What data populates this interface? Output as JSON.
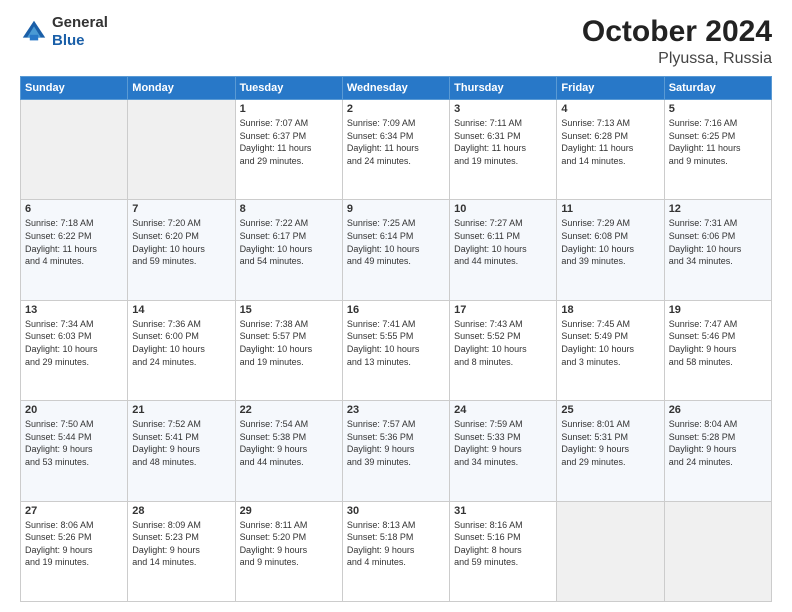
{
  "header": {
    "logo_general": "General",
    "logo_blue": "Blue",
    "month": "October 2024",
    "location": "Plyussa, Russia"
  },
  "days_of_week": [
    "Sunday",
    "Monday",
    "Tuesday",
    "Wednesday",
    "Thursday",
    "Friday",
    "Saturday"
  ],
  "weeks": [
    [
      {
        "day": "",
        "info": ""
      },
      {
        "day": "",
        "info": ""
      },
      {
        "day": "1",
        "info": "Sunrise: 7:07 AM\nSunset: 6:37 PM\nDaylight: 11 hours\nand 29 minutes."
      },
      {
        "day": "2",
        "info": "Sunrise: 7:09 AM\nSunset: 6:34 PM\nDaylight: 11 hours\nand 24 minutes."
      },
      {
        "day": "3",
        "info": "Sunrise: 7:11 AM\nSunset: 6:31 PM\nDaylight: 11 hours\nand 19 minutes."
      },
      {
        "day": "4",
        "info": "Sunrise: 7:13 AM\nSunset: 6:28 PM\nDaylight: 11 hours\nand 14 minutes."
      },
      {
        "day": "5",
        "info": "Sunrise: 7:16 AM\nSunset: 6:25 PM\nDaylight: 11 hours\nand 9 minutes."
      }
    ],
    [
      {
        "day": "6",
        "info": "Sunrise: 7:18 AM\nSunset: 6:22 PM\nDaylight: 11 hours\nand 4 minutes."
      },
      {
        "day": "7",
        "info": "Sunrise: 7:20 AM\nSunset: 6:20 PM\nDaylight: 10 hours\nand 59 minutes."
      },
      {
        "day": "8",
        "info": "Sunrise: 7:22 AM\nSunset: 6:17 PM\nDaylight: 10 hours\nand 54 minutes."
      },
      {
        "day": "9",
        "info": "Sunrise: 7:25 AM\nSunset: 6:14 PM\nDaylight: 10 hours\nand 49 minutes."
      },
      {
        "day": "10",
        "info": "Sunrise: 7:27 AM\nSunset: 6:11 PM\nDaylight: 10 hours\nand 44 minutes."
      },
      {
        "day": "11",
        "info": "Sunrise: 7:29 AM\nSunset: 6:08 PM\nDaylight: 10 hours\nand 39 minutes."
      },
      {
        "day": "12",
        "info": "Sunrise: 7:31 AM\nSunset: 6:06 PM\nDaylight: 10 hours\nand 34 minutes."
      }
    ],
    [
      {
        "day": "13",
        "info": "Sunrise: 7:34 AM\nSunset: 6:03 PM\nDaylight: 10 hours\nand 29 minutes."
      },
      {
        "day": "14",
        "info": "Sunrise: 7:36 AM\nSunset: 6:00 PM\nDaylight: 10 hours\nand 24 minutes."
      },
      {
        "day": "15",
        "info": "Sunrise: 7:38 AM\nSunset: 5:57 PM\nDaylight: 10 hours\nand 19 minutes."
      },
      {
        "day": "16",
        "info": "Sunrise: 7:41 AM\nSunset: 5:55 PM\nDaylight: 10 hours\nand 13 minutes."
      },
      {
        "day": "17",
        "info": "Sunrise: 7:43 AM\nSunset: 5:52 PM\nDaylight: 10 hours\nand 8 minutes."
      },
      {
        "day": "18",
        "info": "Sunrise: 7:45 AM\nSunset: 5:49 PM\nDaylight: 10 hours\nand 3 minutes."
      },
      {
        "day": "19",
        "info": "Sunrise: 7:47 AM\nSunset: 5:46 PM\nDaylight: 9 hours\nand 58 minutes."
      }
    ],
    [
      {
        "day": "20",
        "info": "Sunrise: 7:50 AM\nSunset: 5:44 PM\nDaylight: 9 hours\nand 53 minutes."
      },
      {
        "day": "21",
        "info": "Sunrise: 7:52 AM\nSunset: 5:41 PM\nDaylight: 9 hours\nand 48 minutes."
      },
      {
        "day": "22",
        "info": "Sunrise: 7:54 AM\nSunset: 5:38 PM\nDaylight: 9 hours\nand 44 minutes."
      },
      {
        "day": "23",
        "info": "Sunrise: 7:57 AM\nSunset: 5:36 PM\nDaylight: 9 hours\nand 39 minutes."
      },
      {
        "day": "24",
        "info": "Sunrise: 7:59 AM\nSunset: 5:33 PM\nDaylight: 9 hours\nand 34 minutes."
      },
      {
        "day": "25",
        "info": "Sunrise: 8:01 AM\nSunset: 5:31 PM\nDaylight: 9 hours\nand 29 minutes."
      },
      {
        "day": "26",
        "info": "Sunrise: 8:04 AM\nSunset: 5:28 PM\nDaylight: 9 hours\nand 24 minutes."
      }
    ],
    [
      {
        "day": "27",
        "info": "Sunrise: 8:06 AM\nSunset: 5:26 PM\nDaylight: 9 hours\nand 19 minutes."
      },
      {
        "day": "28",
        "info": "Sunrise: 8:09 AM\nSunset: 5:23 PM\nDaylight: 9 hours\nand 14 minutes."
      },
      {
        "day": "29",
        "info": "Sunrise: 8:11 AM\nSunset: 5:20 PM\nDaylight: 9 hours\nand 9 minutes."
      },
      {
        "day": "30",
        "info": "Sunrise: 8:13 AM\nSunset: 5:18 PM\nDaylight: 9 hours\nand 4 minutes."
      },
      {
        "day": "31",
        "info": "Sunrise: 8:16 AM\nSunset: 5:16 PM\nDaylight: 8 hours\nand 59 minutes."
      },
      {
        "day": "",
        "info": ""
      },
      {
        "day": "",
        "info": ""
      }
    ]
  ]
}
